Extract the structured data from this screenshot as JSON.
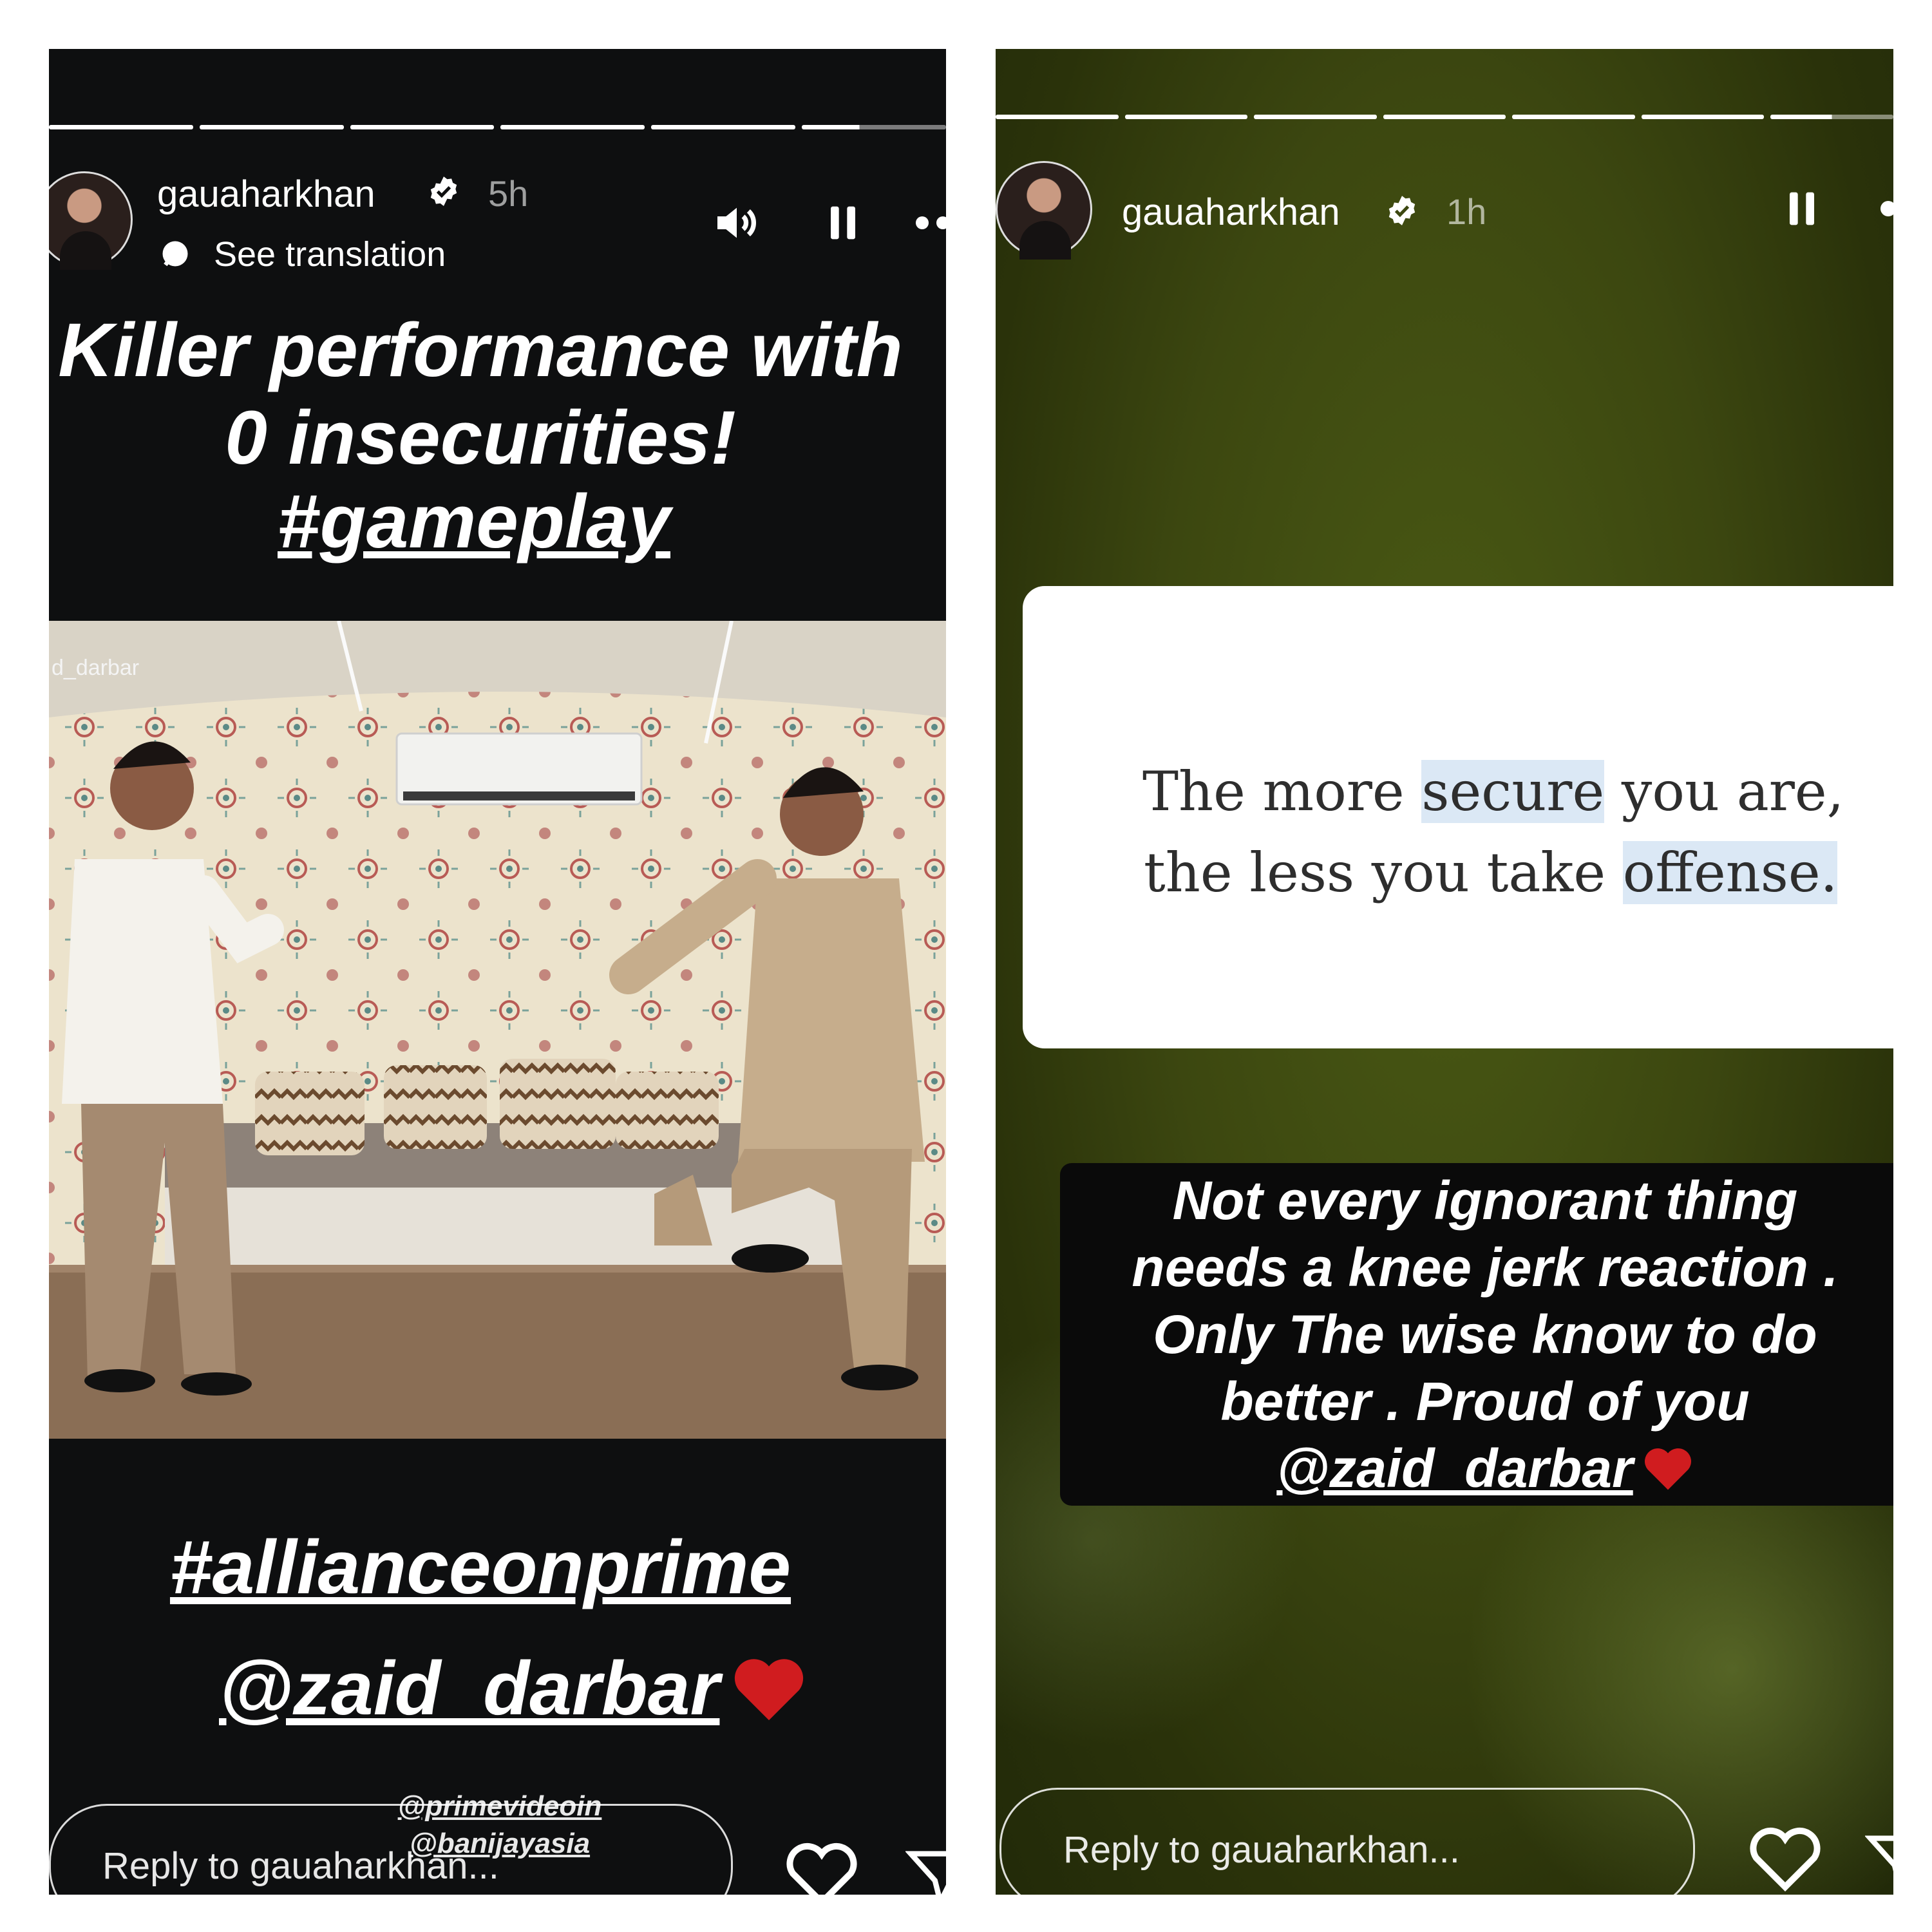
{
  "left_story": {
    "username": "gauaharkhan",
    "time": "5h",
    "see_translation": "See translation",
    "headline": [
      "Killer performance with",
      "0 insecurities!"
    ],
    "hashtag_top": "#gameplay",
    "video_watermark": "d_darbar",
    "hashtag_bottom": "#allianceonprime",
    "mention": "@zaid_darbar",
    "small_mentions": [
      "@primevideoin",
      "@banijayasia"
    ],
    "reply_placeholder": "Reply to gauaharkhan...",
    "icons": [
      "verified-badge-icon",
      "speaker-icon",
      "pause-icon",
      "more-icon",
      "heart-icon",
      "send-icon",
      "heart-emoji-icon"
    ]
  },
  "right_story": {
    "username": "gauaharkhan",
    "time": "1h",
    "quote_line1_pre": "The more ",
    "quote_line1_highlight": "secure",
    "quote_line1_post": " you are,",
    "quote_line2_pre": "the less you take ",
    "quote_line2_highlight": "offense.",
    "caption_lines": [
      "Not every ignorant thing",
      "needs a knee jerk reaction .",
      "Only The wise know to do",
      "better . Proud of you"
    ],
    "mention": "@zaid_darbar",
    "reply_placeholder": "Reply to gauaharkhan...",
    "icons": [
      "verified-badge-icon",
      "pause-icon",
      "more-icon",
      "heart-icon",
      "send-icon",
      "heart-emoji-icon"
    ]
  },
  "colors": {
    "left_bg": "#0e0f10",
    "right_bg": "#3c4710",
    "highlight": "#dbe8f5",
    "heart": "#d01c1f"
  }
}
